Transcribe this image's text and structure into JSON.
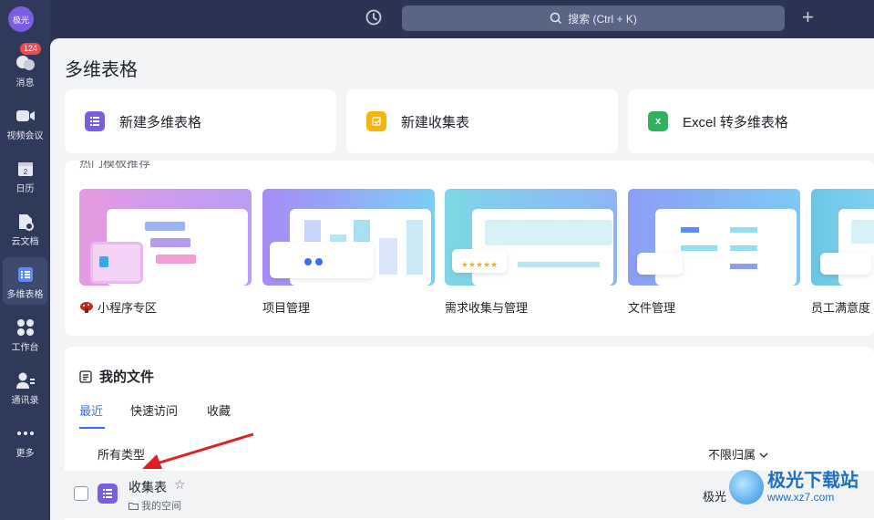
{
  "app": {
    "avatar_label": "极光"
  },
  "sidebar": {
    "items": [
      {
        "label": "消息",
        "badge": "124"
      },
      {
        "label": "视频会议"
      },
      {
        "label": "日历",
        "icon_text": "2"
      },
      {
        "label": "云文档"
      },
      {
        "label": "多维表格"
      },
      {
        "label": "工作台"
      },
      {
        "label": "通讯录"
      },
      {
        "label": "更多"
      }
    ]
  },
  "topbar": {
    "search_placeholder": "搜索 (Ctrl + K)",
    "plus_label": "+"
  },
  "page": {
    "title": "多维表格"
  },
  "quick_cards": [
    {
      "label": "新建多维表格",
      "icon": "bitable-icon",
      "color": "#7b5de0"
    },
    {
      "label": "新建收集表",
      "icon": "form-icon",
      "color": "#f5b40f"
    },
    {
      "label": "Excel 转多维表格",
      "icon": "excel-icon",
      "color": "#2fb15e"
    }
  ],
  "templates": {
    "section_title": "热门模板推荐",
    "items": [
      {
        "label": "小程序专区",
        "icon": "mushroom-icon"
      },
      {
        "label": "项目管理"
      },
      {
        "label": "需求收集与管理"
      },
      {
        "label": "文件管理"
      },
      {
        "label": "员工满意度"
      }
    ]
  },
  "files": {
    "title": "我的文件",
    "tabs": [
      "最近",
      "快速访问",
      "收藏"
    ],
    "filter_type": "所有类型",
    "filter_owner": "不限归属",
    "rows": [
      {
        "name": "收集表",
        "location": "我的空间",
        "owner": "极光"
      }
    ]
  },
  "watermark": {
    "title": "极光下载站",
    "url": "www.xz7.com"
  },
  "colors": {
    "accent": "#3370ff",
    "sidebar": "#2f3a5a",
    "arrow": "#e02020"
  }
}
